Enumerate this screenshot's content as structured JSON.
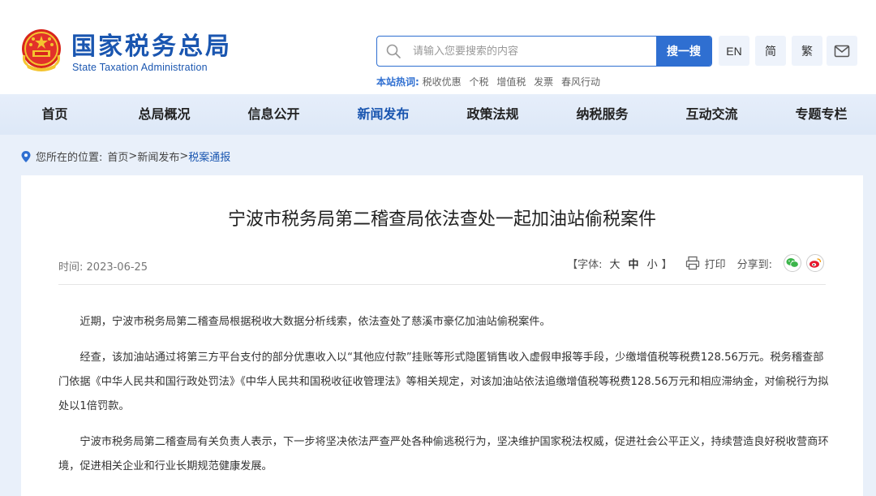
{
  "header": {
    "logo_cn": "国家税务总局",
    "logo_en": "State Taxation Administration",
    "search_placeholder": "请输入您要搜索的内容",
    "search_button": "搜一搜",
    "lang_en": "EN",
    "lang_simplified": "简",
    "lang_traditional": "繁",
    "hot_label": "本站热词:",
    "hot_words": [
      "税收优惠",
      "个税",
      "增值税",
      "发票",
      "春风行动"
    ]
  },
  "nav": {
    "items": [
      "首页",
      "总局概况",
      "信息公开",
      "新闻发布",
      "政策法规",
      "纳税服务",
      "互动交流",
      "专题专栏"
    ],
    "active": "新闻发布"
  },
  "breadcrumb": {
    "prefix": "您所在的位置:",
    "home": "首页",
    "sep1": ">",
    "section": "新闻发布",
    "sep2": ">",
    "current": "税案通报"
  },
  "article": {
    "title": "宁波市税务局第二稽查局依法查处一起加油站偷税案件",
    "time_label": "时间:",
    "time": "2023-06-25",
    "font_open": "【字体:",
    "font_large": "大",
    "font_mid": "中",
    "font_small": "小",
    "font_close": "】",
    "print": "打印",
    "share": "分享到:",
    "paragraphs": [
      "近期，宁波市税务局第二稽查局根据税收大数据分析线索，依法查处了慈溪市豪亿加油站偷税案件。",
      "经查，该加油站通过将第三方平台支付的部分优惠收入以“其他应付款”挂账等形式隐匿销售收入虚假申报等手段，少缴增值税等税费128.56万元。税务稽查部门依据《中华人民共和国行政处罚法》《中华人民共和国税收征收管理法》等相关规定，对该加油站依法追缴增值税等税费128.56万元和相应滞纳金，对偷税行为拟处以1倍罚款。",
      "宁波市税务局第二稽查局有关负责人表示，下一步将坚决依法严查严处各种偷逃税行为，坚决维护国家税法权威，促进社会公平正义，持续营造良好税收营商环境，促进相关企业和行业长期规范健康发展。"
    ]
  },
  "colors": {
    "brand_blue": "#1a56b0",
    "button_blue": "#2f6fd1",
    "nav_bg": "#e6eefa",
    "page_bg": "#e9f0fa"
  }
}
